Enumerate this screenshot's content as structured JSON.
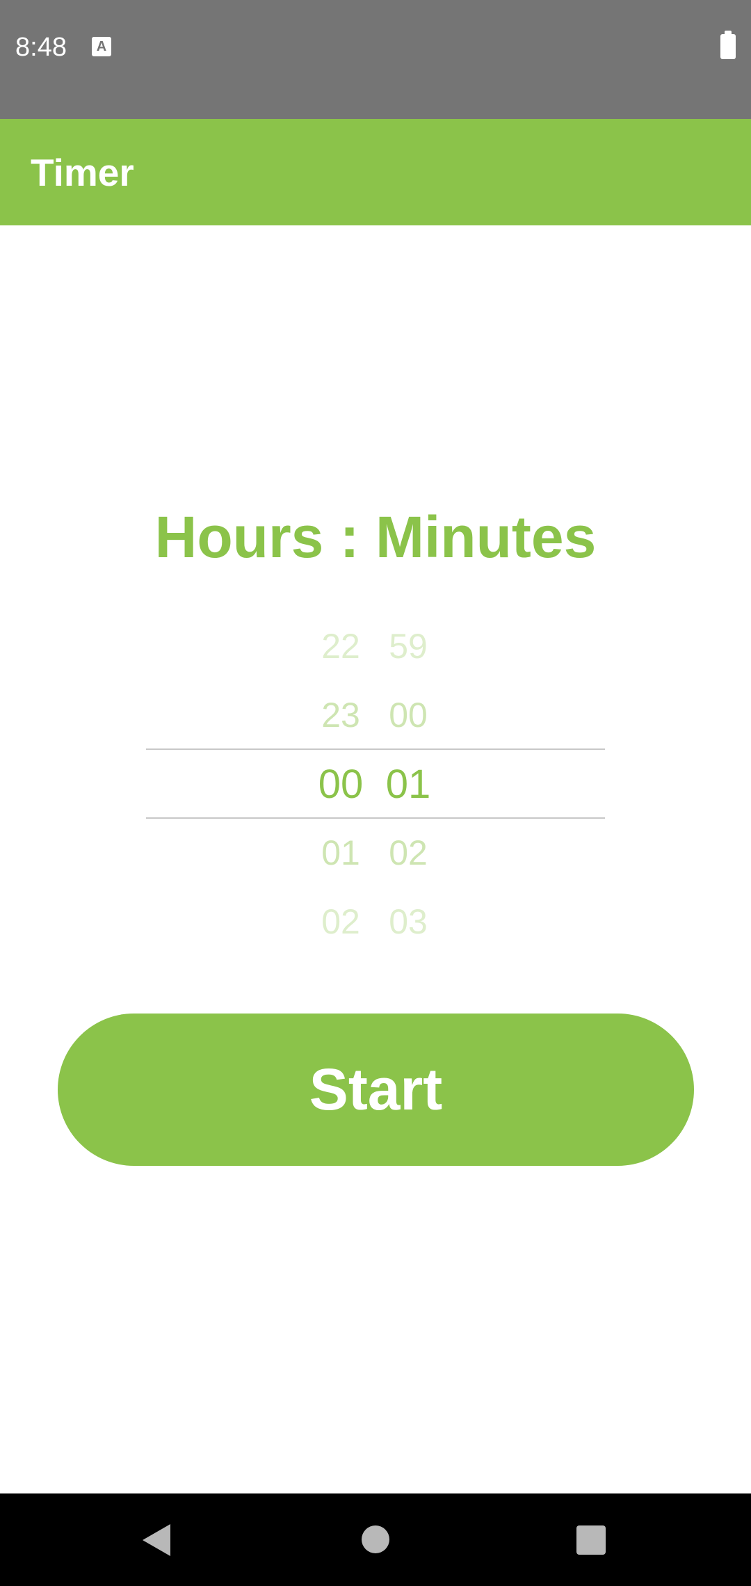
{
  "status_bar": {
    "time": "8:48",
    "notification_glyph": "A",
    "icons": [
      "keyboard-notification-icon",
      "battery-full-icon"
    ]
  },
  "app_bar": {
    "title": "Timer"
  },
  "picker": {
    "heading": "Hours : Minutes",
    "hours": [
      "22",
      "23",
      "00",
      "01",
      "02"
    ],
    "minutes": [
      "59",
      "00",
      "01",
      "02",
      "03"
    ],
    "selected_hours": "00",
    "selected_minutes": "01"
  },
  "start_button": {
    "label": "Start"
  },
  "nav_bar": {
    "icons": [
      "back-icon",
      "home-icon",
      "recents-icon"
    ]
  },
  "colors": {
    "accent": "#8bc34a",
    "status_bar": "#757575",
    "nav_bar": "#000000",
    "background": "#ffffff"
  }
}
